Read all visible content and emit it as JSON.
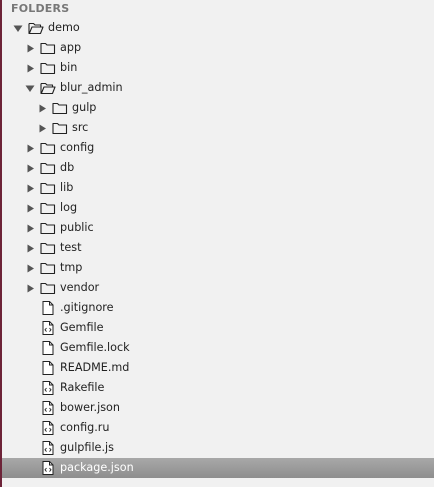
{
  "sidebar": {
    "header": "FOLDERS",
    "items": [
      {
        "label": "demo",
        "type": "folder",
        "depth": 0,
        "expanded": true
      },
      {
        "label": "app",
        "type": "folder",
        "depth": 1,
        "expanded": false
      },
      {
        "label": "bin",
        "type": "folder",
        "depth": 1,
        "expanded": false
      },
      {
        "label": "blur_admin",
        "type": "folder",
        "depth": 1,
        "expanded": true
      },
      {
        "label": "gulp",
        "type": "folder",
        "depth": 2,
        "expanded": false
      },
      {
        "label": "src",
        "type": "folder",
        "depth": 2,
        "expanded": false
      },
      {
        "label": "config",
        "type": "folder",
        "depth": 1,
        "expanded": false
      },
      {
        "label": "db",
        "type": "folder",
        "depth": 1,
        "expanded": false
      },
      {
        "label": "lib",
        "type": "folder",
        "depth": 1,
        "expanded": false
      },
      {
        "label": "log",
        "type": "folder",
        "depth": 1,
        "expanded": false
      },
      {
        "label": "public",
        "type": "folder",
        "depth": 1,
        "expanded": false
      },
      {
        "label": "test",
        "type": "folder",
        "depth": 1,
        "expanded": false
      },
      {
        "label": "tmp",
        "type": "folder",
        "depth": 1,
        "expanded": false
      },
      {
        "label": "vendor",
        "type": "folder",
        "depth": 1,
        "expanded": false
      },
      {
        "label": ".gitignore",
        "type": "file",
        "depth": 1,
        "icon": "file-icon"
      },
      {
        "label": "Gemfile",
        "type": "file",
        "depth": 1,
        "icon": "code-file-icon"
      },
      {
        "label": "Gemfile.lock",
        "type": "file",
        "depth": 1,
        "icon": "file-icon"
      },
      {
        "label": "README.md",
        "type": "file",
        "depth": 1,
        "icon": "file-icon"
      },
      {
        "label": "Rakefile",
        "type": "file",
        "depth": 1,
        "icon": "code-file-icon"
      },
      {
        "label": "bower.json",
        "type": "file",
        "depth": 1,
        "icon": "code-file-icon"
      },
      {
        "label": "config.ru",
        "type": "file",
        "depth": 1,
        "icon": "code-file-icon"
      },
      {
        "label": "gulpfile.js",
        "type": "file",
        "depth": 1,
        "icon": "code-file-icon"
      },
      {
        "label": "package.json",
        "type": "file",
        "depth": 1,
        "icon": "code-file-icon",
        "selected": true
      }
    ]
  },
  "colors": {
    "panel_bg": "#f1f1f1",
    "accent_edge": "#6d2338",
    "selected_bg": "#9a9a9a",
    "selected_text": "#ffffff"
  }
}
